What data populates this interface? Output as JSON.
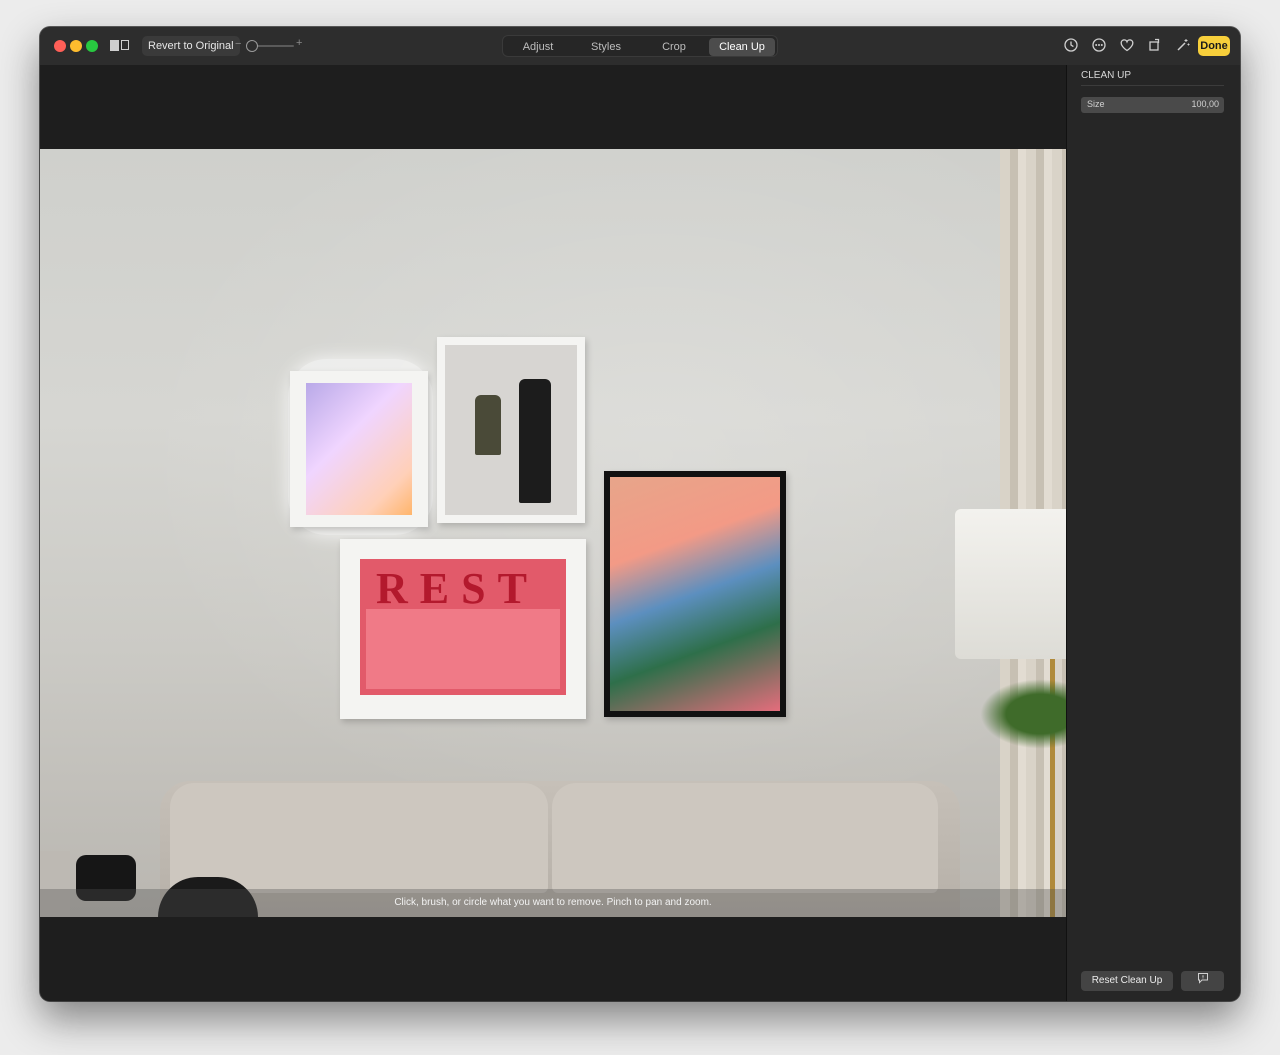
{
  "toolbar": {
    "revert_label": "Revert to Original",
    "zoom_minus": "−",
    "zoom_plus": "+",
    "tabs": [
      {
        "label": "Adjust"
      },
      {
        "label": "Styles"
      },
      {
        "label": "Crop"
      },
      {
        "label": "Clean Up"
      }
    ],
    "active_tab": "Clean Up",
    "icons": [
      "history-icon",
      "more-icon",
      "favorite-icon",
      "rotate-icon",
      "magic-wand-icon"
    ],
    "done_label": "Done"
  },
  "photo": {
    "poster_text": "REST"
  },
  "hint": {
    "text": "Click, brush, or circle what you want to remove. Pinch to pan and zoom."
  },
  "sidebar": {
    "title": "CLEAN UP",
    "size_label": "Size",
    "size_value": "100,00",
    "reset_label": "Reset Clean Up"
  },
  "colors": {
    "done_button": "#f7cf3b",
    "window_bg": "#1e1e1e",
    "sidebar_bg": "#262626"
  }
}
